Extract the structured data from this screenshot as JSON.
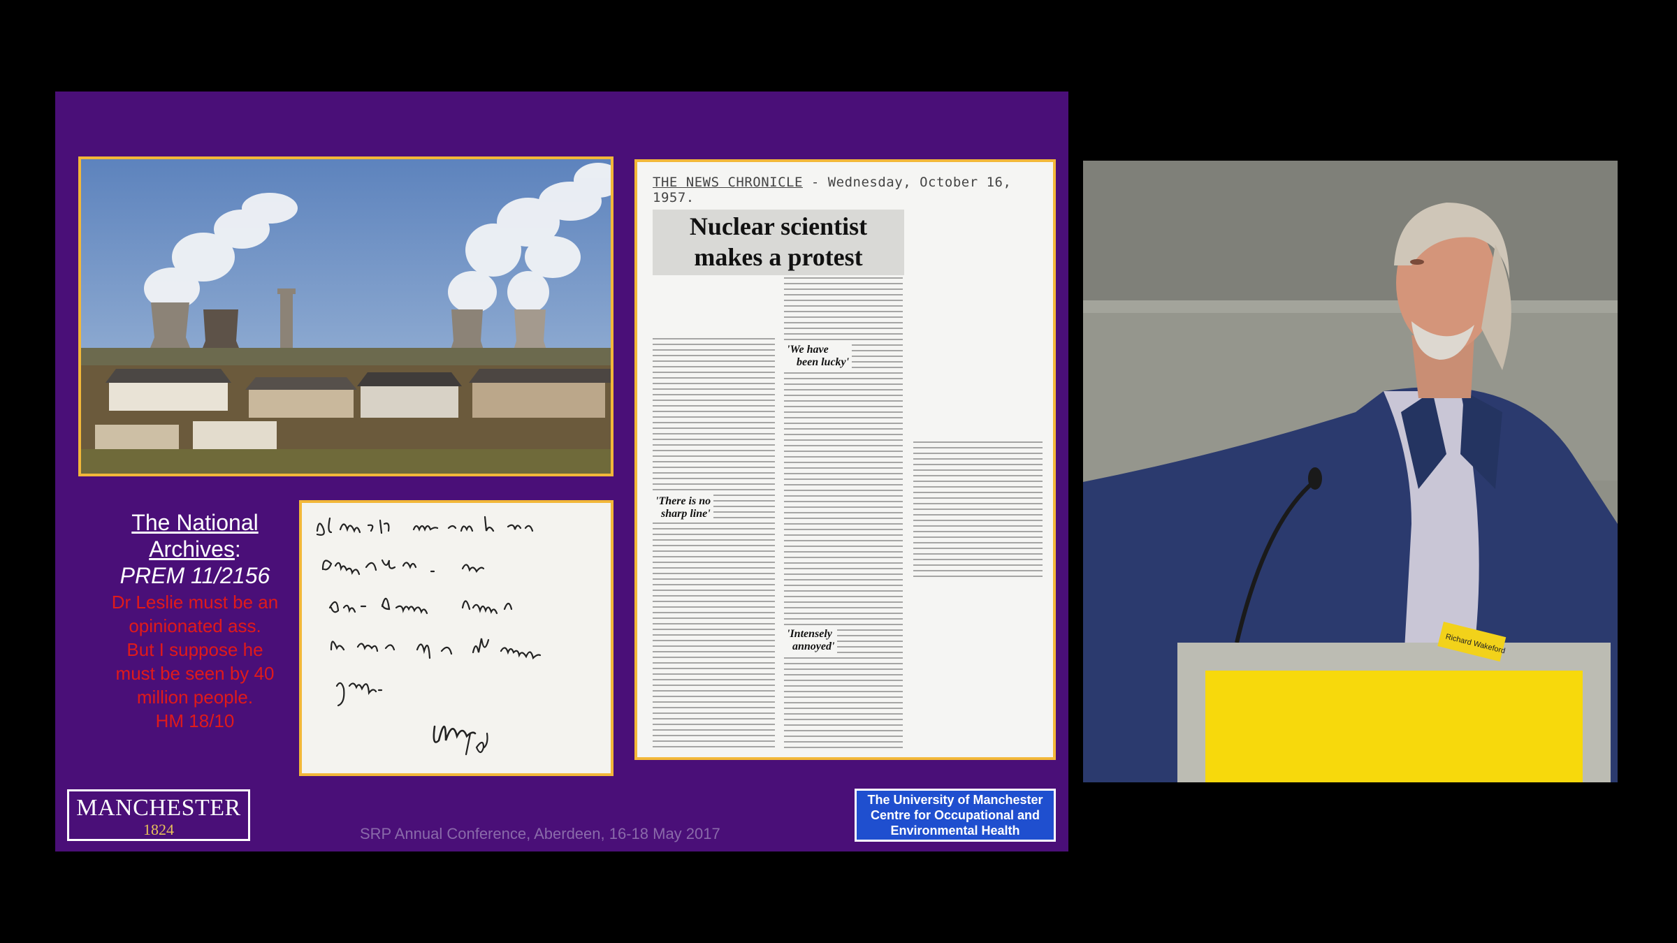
{
  "slide": {
    "archive_caption": {
      "line1": "The National",
      "line2": "Archives",
      "line2_suffix": ":",
      "reference": "PREM 11/2156",
      "transcript": [
        "Dr Leslie must be an",
        "opinionated ass.",
        "But I suppose he",
        "must be seen by 40",
        "million people.",
        "HM 18/10"
      ]
    },
    "handwritten_note": "Dr Leslie must be an opinionated ass. But I suppose he must be seen by 40 million people.",
    "handwritten_signature": "18/10",
    "clipping": {
      "newspaper": "THE NEWS CHRONICLE",
      "date": "- Wednesday, October 16, 1957.",
      "headline_line1": "Nuclear scientist",
      "headline_line2": "makes a protest",
      "subheads": [
        "'We have",
        "been lucky'",
        "'There is no",
        "sharp line'",
        "'Intensely",
        "annoyed'"
      ]
    },
    "logo": {
      "word": "MANCHESTER",
      "year": "1824"
    },
    "footer": "SRP Annual Conference, Aberdeen, 16-18 May 2017",
    "university_box": [
      "The University of Manchester",
      "Centre for Occupational and",
      "Environmental Health"
    ]
  },
  "speaker": {
    "badge": "Richard Wakeford"
  },
  "colors": {
    "slide_background": "#4a0f78",
    "frame": "#f2b739",
    "transcript_red": "#e01a1a",
    "university_blue": "#1f4fcf",
    "podium_yellow": "#f7d90c"
  }
}
